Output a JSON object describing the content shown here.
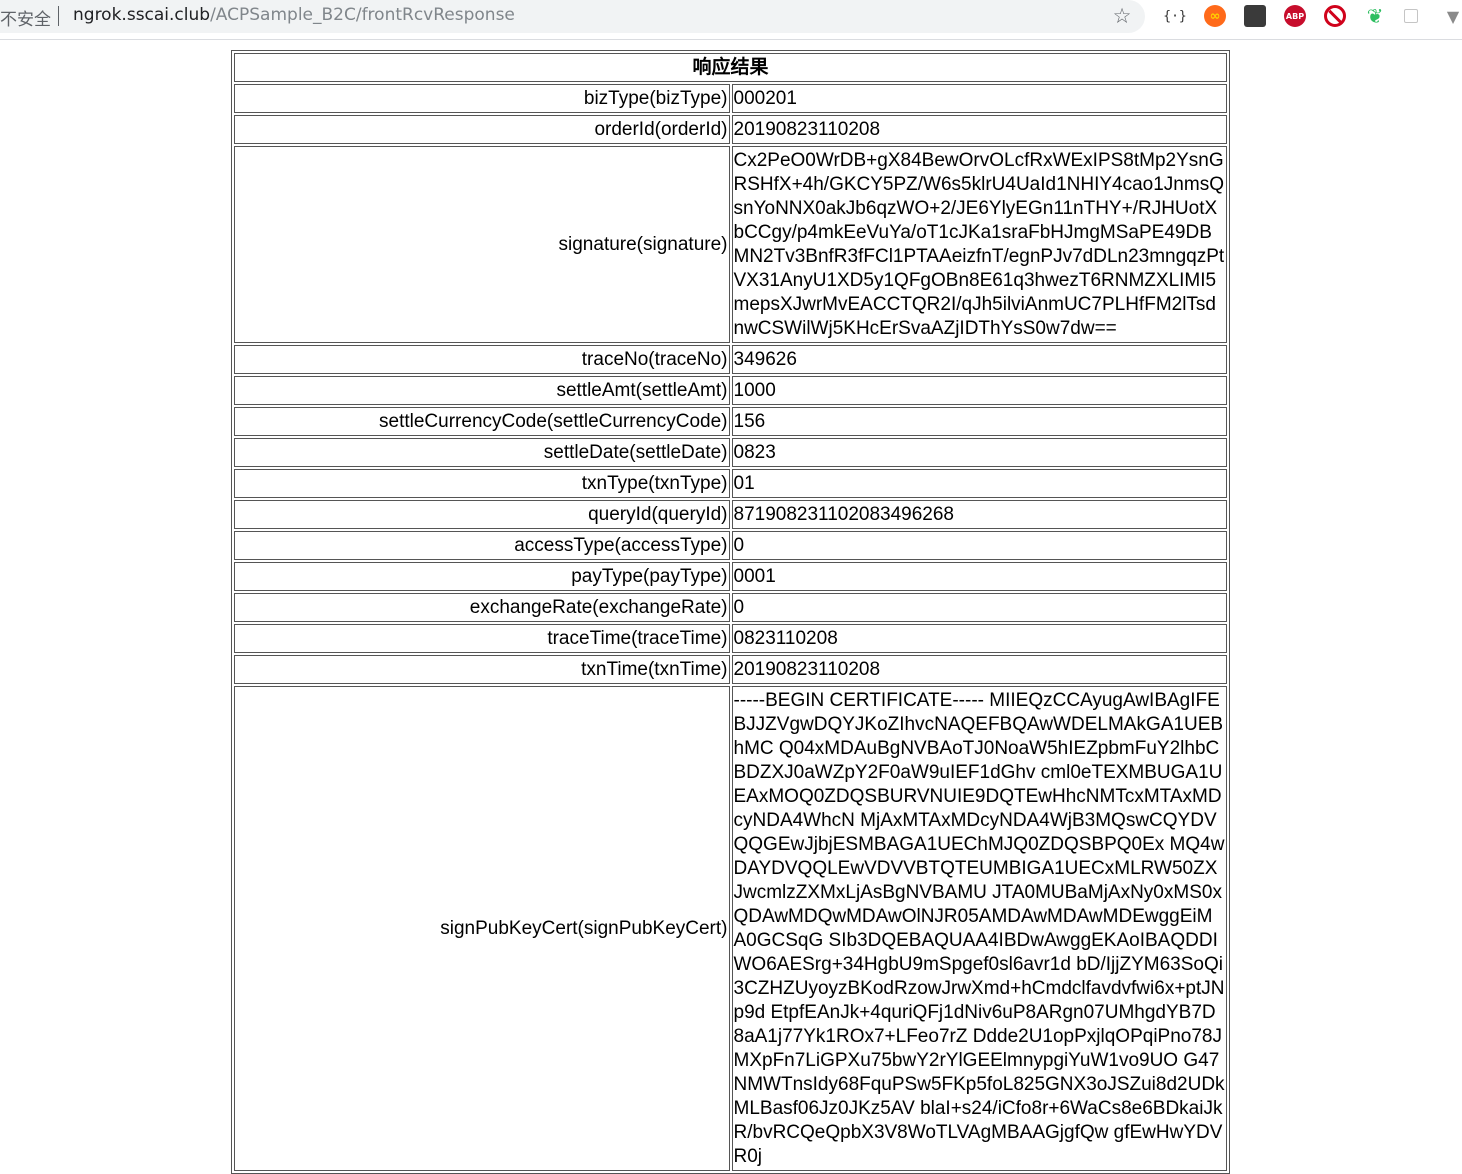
{
  "browser": {
    "security_text": "不安全",
    "url_host": "ngrok.sscai.club",
    "url_path": "/ACPSample_B2C/frontRcvResponse",
    "star_icon": "☆",
    "ext_json_label": "{·}",
    "ext_abp_label": "ABP"
  },
  "page": {
    "title": "响应结果",
    "rows": [
      {
        "key": "bizType(bizType)",
        "value": "000201"
      },
      {
        "key": "orderId(orderId)",
        "value": "20190823110208"
      },
      {
        "key": "signature(signature)",
        "value": "Cx2PeO0WrDB+gX84BewOrvOLcfRxWExIPS8tMp2YsnGRSHfX+4h/GKCY5PZ/W6s5klrU4UaId1NHIY4cao1JnmsQsnYoNNX0akJb6qzWO+2/JE6YlyEGn11nTHY+/RJHUotXbCCgy/p4mkEeVuYa/oT1cJKa1sraFbHJmgMSaPE49DBMN2Tv3BnfR3fFCl1PTAAeizfnT/egnPJv7dDLn23mngqzPtVX31AnyU1XD5y1QFgOBn8E61q3hwezT6RNMZXLIMI5mepsXJwrMvEACCTQR2I/qJh5ilviAnmUC7PLHfFM2lTsdnwCSWilWj5KHcErSvaAZjIDThYsS0w7dw=="
      },
      {
        "key": "traceNo(traceNo)",
        "value": "349626"
      },
      {
        "key": "settleAmt(settleAmt)",
        "value": "1000"
      },
      {
        "key": "settleCurrencyCode(settleCurrencyCode)",
        "value": "156"
      },
      {
        "key": "settleDate(settleDate)",
        "value": "0823"
      },
      {
        "key": "txnType(txnType)",
        "value": "01"
      },
      {
        "key": "queryId(queryId)",
        "value": "871908231102083496268"
      },
      {
        "key": "accessType(accessType)",
        "value": "0"
      },
      {
        "key": "payType(payType)",
        "value": "0001"
      },
      {
        "key": "exchangeRate(exchangeRate)",
        "value": "0"
      },
      {
        "key": "traceTime(traceTime)",
        "value": "0823110208"
      },
      {
        "key": "txnTime(txnTime)",
        "value": "20190823110208"
      },
      {
        "key": "signPubKeyCert(signPubKeyCert)",
        "value": "-----BEGIN CERTIFICATE----- MIIEQzCCAyugAwIBAgIFEBJJZVgwDQYJKoZIhvcNAQEFBQAwWDELMAkGA1UEBhMC Q04xMDAuBgNVBAoTJ0NoaW5hIEZpbmFuY2lhbCBDZXJ0aWZpY2F0aW9uIEF1dGhv cml0eTEXMBUGA1UEAxMOQ0ZDQSBURVNUIE9DQTEwHhcNMTcxMTAxMDcyNDA4WhcN MjAxMTAxMDcyNDA4WjB3MQswCQYDVQQGEwJjbjESMBAGA1UEChMJQ0ZDQSBPQ0Ex MQ4wDAYDVQQLEwVDVVBTQTEUMBIGA1UECxMLRW50ZXJwcmlzZXMxLjAsBgNVBAMU JTA0MUBaMjAxNy0xMS0xQDAwMDQwMDAwOlNJR05AMDAwMDAwMDEwggEiMA0GCSqG SIb3DQEBAQUAA4IBDwAwggEKAoIBAQDDIWO6AESrg+34HgbU9mSpgef0sl6avr1d bD/IjjZYM63SoQi3CZHZUyoyzBKodRzowJrwXmd+hCmdclfavdvfwi6x+ptJNp9d EtpfEAnJk+4quriQFj1dNiv6uP8ARgn07UMhgdYB7D8aA1j77Yk1ROx7+LFeo7rZ Ddde2U1opPxjlqOPqiPno78JMXpFn7LiGPXu75bwY2rYlGEElmnypgiYuW1vo9UO G47NMWTnsIdy68FquPSw5FKp5foL825GNX3oJSZui8d2UDkMLBasf06Jz0JKz5AV blaI+s24/iCfo8r+6WaCs8e6BDkaiJkR/bvRCQeQpbX3V8WoTLVAgMBAAGjgfQw gfEwHwYDVR0j"
      }
    ]
  }
}
